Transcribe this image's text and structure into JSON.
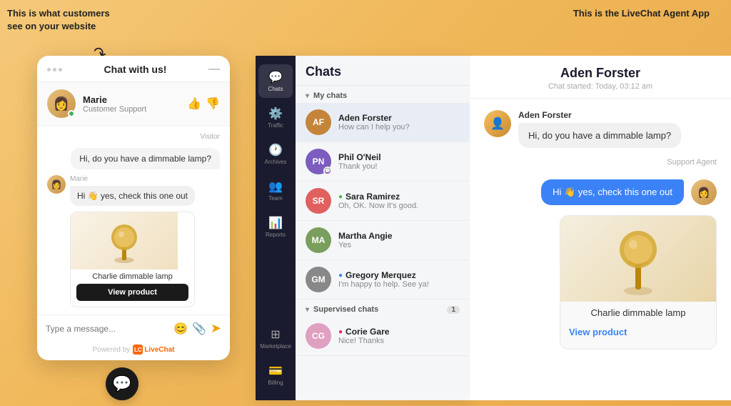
{
  "annotations": {
    "left_text": "This is what customers see on your website",
    "right_text": "This is the LiveChat Agent App"
  },
  "widget": {
    "title": "Chat with us!",
    "agent_name": "Marie",
    "agent_role": "Customer Support",
    "messages": [
      {
        "type": "visitor",
        "label": "Visitor",
        "text": "Hi, do you have a dimmable lamp?"
      },
      {
        "type": "agent",
        "name": "Marie",
        "text": "Hi 👋 yes, check this one out"
      }
    ],
    "product": {
      "name": "Charlie dimmable lamp",
      "btn_label": "View product"
    },
    "input_placeholder": "Type a message...",
    "footer_powered": "Powered by",
    "footer_brand": "LiveChat"
  },
  "app": {
    "sidebar": [
      {
        "icon": "💬",
        "label": "Chats",
        "active": true
      },
      {
        "icon": "⚙",
        "label": "Traffic",
        "active": false
      },
      {
        "icon": "🕐",
        "label": "Archives",
        "active": false
      },
      {
        "icon": "👥",
        "label": "Team",
        "active": false
      },
      {
        "icon": "📊",
        "label": "Reports",
        "active": false
      },
      {
        "icon": "⊞",
        "label": "Marketplace",
        "active": false
      },
      {
        "icon": "💳",
        "label": "Billing",
        "active": false
      }
    ],
    "header": "Chats",
    "sections": [
      {
        "label": "My chats",
        "count": null,
        "chats": [
          {
            "name": "Aden Forster",
            "preview": "How can I help you?",
            "avatar_color": "#c4843a",
            "initials": "AF",
            "active": true
          },
          {
            "name": "Phil O'Neil",
            "preview": "Thank you!",
            "avatar_color": "#7c5cbf",
            "initials": "PN",
            "active": false
          },
          {
            "name": "Sara Ramirez",
            "preview": "Oh, OK. Now It's good.",
            "avatar_color": "#e06060",
            "initials": "SR",
            "active": false
          },
          {
            "name": "Martha Angie",
            "preview": "Yes",
            "avatar_color": "#7a9e5e",
            "initials": "MA",
            "active": false
          },
          {
            "name": "Gregory Merquez",
            "preview": "I'm happy to help. See ya!",
            "avatar_color": "#888",
            "initials": "GM",
            "active": false
          }
        ]
      },
      {
        "label": "Supervised chats",
        "count": "1",
        "chats": [
          {
            "name": "Corie Gare",
            "preview": "Nice! Thanks",
            "avatar_color": "#e0a0c0",
            "initials": "CG",
            "active": false
          }
        ]
      }
    ]
  },
  "agent_panel": {
    "customer_name": "Aden Forster",
    "chat_started": "Chat started: Today, 03:12 am",
    "visitor_name": "Aden Forster",
    "visitor_msg": "Hi, do you have a dimmable lamp?",
    "agent_label": "Support Agent",
    "agent_msg": "Hi 👋 yes, check this one out",
    "product": {
      "name": "Charlie dimmable lamp",
      "btn_label": "View product"
    }
  }
}
